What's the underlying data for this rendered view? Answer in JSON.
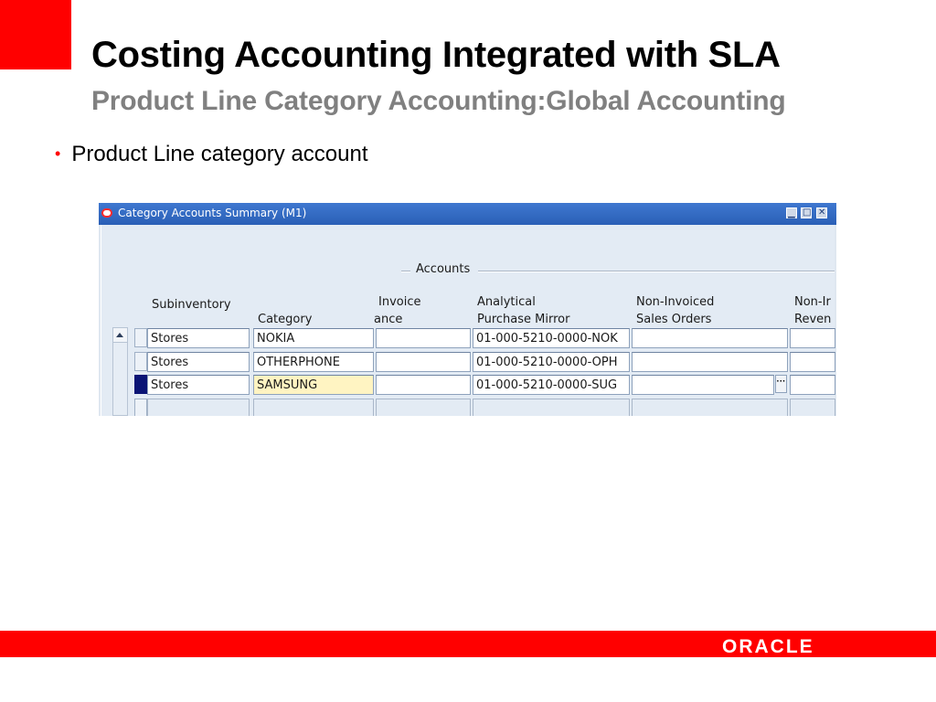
{
  "slide": {
    "title": "Costing Accounting Integrated with SLA",
    "subtitle": "Product Line Category Accounting:Global Accounting",
    "bullet": "Product Line category account",
    "footer_logo": "ORACLE",
    "accent_color": "#ff0000",
    "subtitle_color": "#808080"
  },
  "window": {
    "title": "Category Accounts Summary (M1)",
    "controls": {
      "minimize": "▁",
      "maximize": "□",
      "close": "✕"
    },
    "group_label": "Accounts",
    "headers": {
      "subinventory": "Subinventory",
      "category": "Category",
      "invoice_l1": "Invoice",
      "invoice_l2": "ance",
      "analytical_l1": "Analytical",
      "analytical_l2": "Purchase Mirror",
      "noninv_l1": "Non-Invoiced",
      "noninv_l2": "Sales Orders",
      "nonr_l1": "Non-Ir",
      "nonr_l2": "Reven"
    },
    "rows": [
      {
        "subinventory": "Stores",
        "category": "NOKIA",
        "invoice": "",
        "analytical": "01-000-5210-0000-NOK",
        "noninv": "",
        "nonr": ""
      },
      {
        "subinventory": "Stores",
        "category": "OTHERPHONE",
        "invoice": "",
        "analytical": "01-000-5210-0000-OPH",
        "noninv": "",
        "nonr": ""
      },
      {
        "subinventory": "Stores",
        "category": "SAMSUNG",
        "invoice": "",
        "analytical": "01-000-5210-0000-SUG",
        "noninv": "",
        "nonr": ""
      },
      {
        "subinventory": "",
        "category": "",
        "invoice": "",
        "analytical": "",
        "noninv": "",
        "nonr": ""
      },
      {
        "subinventory": "",
        "category": "",
        "invoice": "",
        "analytical": "",
        "noninv": "",
        "nonr": ""
      }
    ],
    "lov_button": "···"
  }
}
